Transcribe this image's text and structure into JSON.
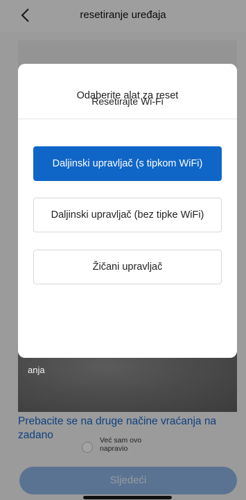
{
  "header": {
    "title": "resetiranje uređaja",
    "back_icon": "chevron-left-icon"
  },
  "main": {
    "card_title": "Resetirajte Wi-Fi",
    "card_caption_partial": "anja",
    "switch_link": "Prebacite se na druge načine vraćanja na zadano",
    "confirm_label": "Već sam ovo napravio",
    "confirm_checked": false,
    "next_button": "Sljedeći"
  },
  "modal": {
    "title": "Odaberite alat za reset",
    "options": [
      {
        "label": "Daljinski upravljač (s tipkom WiFi)",
        "selected": true
      },
      {
        "label": "Daljinski upravljač (bez tipke WiFi)",
        "selected": false
      },
      {
        "label": "Žičani upravljač",
        "selected": false
      }
    ]
  },
  "colors": {
    "accent": "#1066c7",
    "link": "#1765c9",
    "disabled_button": "#8fb4e6",
    "overlay": "rgba(0,0,0,0.36)"
  }
}
